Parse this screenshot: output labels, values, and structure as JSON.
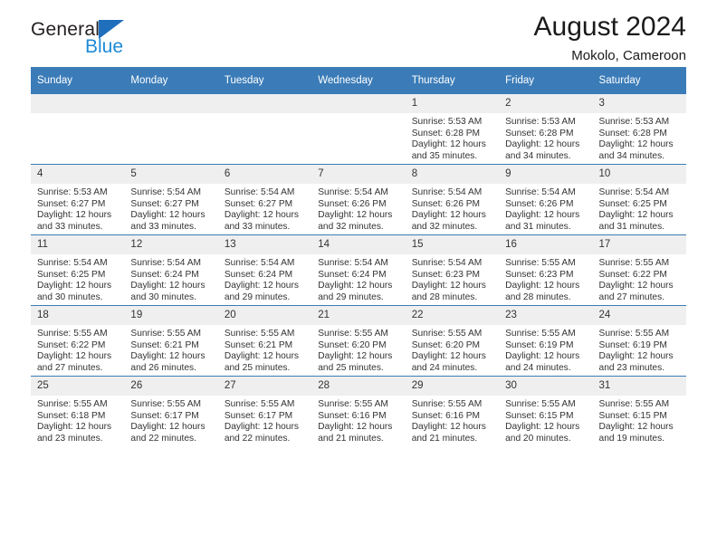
{
  "brand": {
    "name_top": "General",
    "name_bottom": "Blue",
    "triangle_color": "#1f6fbd",
    "blue_text_color": "#1f8ad6"
  },
  "header": {
    "title": "August 2024",
    "subtitle": "Mokolo, Cameroon",
    "header_bg": "#3b7cb8",
    "daynum_bg": "#efefef"
  },
  "weekdays": [
    "Sunday",
    "Monday",
    "Tuesday",
    "Wednesday",
    "Thursday",
    "Friday",
    "Saturday"
  ],
  "labels": {
    "sunrise": "Sunrise:",
    "sunset": "Sunset:",
    "daylight": "Daylight:"
  },
  "weeks": [
    [
      {
        "day": "",
        "empty": true
      },
      {
        "day": "",
        "empty": true
      },
      {
        "day": "",
        "empty": true
      },
      {
        "day": "",
        "empty": true
      },
      {
        "day": "1",
        "sunrise": "Sunrise: 5:53 AM",
        "sunset": "Sunset: 6:28 PM",
        "daylight1": "Daylight: 12 hours",
        "daylight2": "and 35 minutes."
      },
      {
        "day": "2",
        "sunrise": "Sunrise: 5:53 AM",
        "sunset": "Sunset: 6:28 PM",
        "daylight1": "Daylight: 12 hours",
        "daylight2": "and 34 minutes."
      },
      {
        "day": "3",
        "sunrise": "Sunrise: 5:53 AM",
        "sunset": "Sunset: 6:28 PM",
        "daylight1": "Daylight: 12 hours",
        "daylight2": "and 34 minutes."
      }
    ],
    [
      {
        "day": "4",
        "sunrise": "Sunrise: 5:53 AM",
        "sunset": "Sunset: 6:27 PM",
        "daylight1": "Daylight: 12 hours",
        "daylight2": "and 33 minutes."
      },
      {
        "day": "5",
        "sunrise": "Sunrise: 5:54 AM",
        "sunset": "Sunset: 6:27 PM",
        "daylight1": "Daylight: 12 hours",
        "daylight2": "and 33 minutes."
      },
      {
        "day": "6",
        "sunrise": "Sunrise: 5:54 AM",
        "sunset": "Sunset: 6:27 PM",
        "daylight1": "Daylight: 12 hours",
        "daylight2": "and 33 minutes."
      },
      {
        "day": "7",
        "sunrise": "Sunrise: 5:54 AM",
        "sunset": "Sunset: 6:26 PM",
        "daylight1": "Daylight: 12 hours",
        "daylight2": "and 32 minutes."
      },
      {
        "day": "8",
        "sunrise": "Sunrise: 5:54 AM",
        "sunset": "Sunset: 6:26 PM",
        "daylight1": "Daylight: 12 hours",
        "daylight2": "and 32 minutes."
      },
      {
        "day": "9",
        "sunrise": "Sunrise: 5:54 AM",
        "sunset": "Sunset: 6:26 PM",
        "daylight1": "Daylight: 12 hours",
        "daylight2": "and 31 minutes."
      },
      {
        "day": "10",
        "sunrise": "Sunrise: 5:54 AM",
        "sunset": "Sunset: 6:25 PM",
        "daylight1": "Daylight: 12 hours",
        "daylight2": "and 31 minutes."
      }
    ],
    [
      {
        "day": "11",
        "sunrise": "Sunrise: 5:54 AM",
        "sunset": "Sunset: 6:25 PM",
        "daylight1": "Daylight: 12 hours",
        "daylight2": "and 30 minutes."
      },
      {
        "day": "12",
        "sunrise": "Sunrise: 5:54 AM",
        "sunset": "Sunset: 6:24 PM",
        "daylight1": "Daylight: 12 hours",
        "daylight2": "and 30 minutes."
      },
      {
        "day": "13",
        "sunrise": "Sunrise: 5:54 AM",
        "sunset": "Sunset: 6:24 PM",
        "daylight1": "Daylight: 12 hours",
        "daylight2": "and 29 minutes."
      },
      {
        "day": "14",
        "sunrise": "Sunrise: 5:54 AM",
        "sunset": "Sunset: 6:24 PM",
        "daylight1": "Daylight: 12 hours",
        "daylight2": "and 29 minutes."
      },
      {
        "day": "15",
        "sunrise": "Sunrise: 5:54 AM",
        "sunset": "Sunset: 6:23 PM",
        "daylight1": "Daylight: 12 hours",
        "daylight2": "and 28 minutes."
      },
      {
        "day": "16",
        "sunrise": "Sunrise: 5:55 AM",
        "sunset": "Sunset: 6:23 PM",
        "daylight1": "Daylight: 12 hours",
        "daylight2": "and 28 minutes."
      },
      {
        "day": "17",
        "sunrise": "Sunrise: 5:55 AM",
        "sunset": "Sunset: 6:22 PM",
        "daylight1": "Daylight: 12 hours",
        "daylight2": "and 27 minutes."
      }
    ],
    [
      {
        "day": "18",
        "sunrise": "Sunrise: 5:55 AM",
        "sunset": "Sunset: 6:22 PM",
        "daylight1": "Daylight: 12 hours",
        "daylight2": "and 27 minutes."
      },
      {
        "day": "19",
        "sunrise": "Sunrise: 5:55 AM",
        "sunset": "Sunset: 6:21 PM",
        "daylight1": "Daylight: 12 hours",
        "daylight2": "and 26 minutes."
      },
      {
        "day": "20",
        "sunrise": "Sunrise: 5:55 AM",
        "sunset": "Sunset: 6:21 PM",
        "daylight1": "Daylight: 12 hours",
        "daylight2": "and 25 minutes."
      },
      {
        "day": "21",
        "sunrise": "Sunrise: 5:55 AM",
        "sunset": "Sunset: 6:20 PM",
        "daylight1": "Daylight: 12 hours",
        "daylight2": "and 25 minutes."
      },
      {
        "day": "22",
        "sunrise": "Sunrise: 5:55 AM",
        "sunset": "Sunset: 6:20 PM",
        "daylight1": "Daylight: 12 hours",
        "daylight2": "and 24 minutes."
      },
      {
        "day": "23",
        "sunrise": "Sunrise: 5:55 AM",
        "sunset": "Sunset: 6:19 PM",
        "daylight1": "Daylight: 12 hours",
        "daylight2": "and 24 minutes."
      },
      {
        "day": "24",
        "sunrise": "Sunrise: 5:55 AM",
        "sunset": "Sunset: 6:19 PM",
        "daylight1": "Daylight: 12 hours",
        "daylight2": "and 23 minutes."
      }
    ],
    [
      {
        "day": "25",
        "sunrise": "Sunrise: 5:55 AM",
        "sunset": "Sunset: 6:18 PM",
        "daylight1": "Daylight: 12 hours",
        "daylight2": "and 23 minutes."
      },
      {
        "day": "26",
        "sunrise": "Sunrise: 5:55 AM",
        "sunset": "Sunset: 6:17 PM",
        "daylight1": "Daylight: 12 hours",
        "daylight2": "and 22 minutes."
      },
      {
        "day": "27",
        "sunrise": "Sunrise: 5:55 AM",
        "sunset": "Sunset: 6:17 PM",
        "daylight1": "Daylight: 12 hours",
        "daylight2": "and 22 minutes."
      },
      {
        "day": "28",
        "sunrise": "Sunrise: 5:55 AM",
        "sunset": "Sunset: 6:16 PM",
        "daylight1": "Daylight: 12 hours",
        "daylight2": "and 21 minutes."
      },
      {
        "day": "29",
        "sunrise": "Sunrise: 5:55 AM",
        "sunset": "Sunset: 6:16 PM",
        "daylight1": "Daylight: 12 hours",
        "daylight2": "and 21 minutes."
      },
      {
        "day": "30",
        "sunrise": "Sunrise: 5:55 AM",
        "sunset": "Sunset: 6:15 PM",
        "daylight1": "Daylight: 12 hours",
        "daylight2": "and 20 minutes."
      },
      {
        "day": "31",
        "sunrise": "Sunrise: 5:55 AM",
        "sunset": "Sunset: 6:15 PM",
        "daylight1": "Daylight: 12 hours",
        "daylight2": "and 19 minutes."
      }
    ]
  ]
}
